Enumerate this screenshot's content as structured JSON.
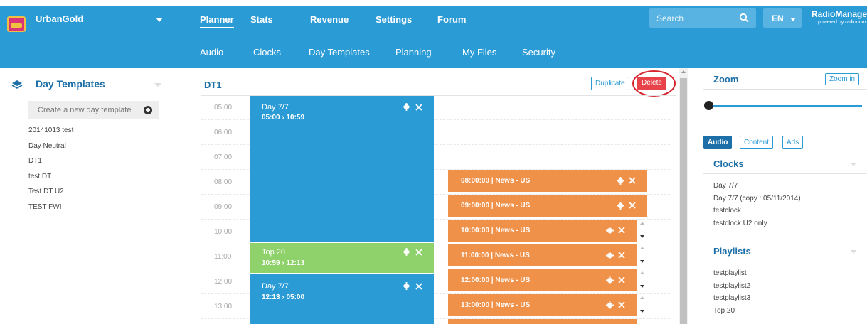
{
  "header": {
    "brand": "UrbanGold",
    "nav": [
      "Planner",
      "Stats",
      "Revenue",
      "Settings",
      "Forum"
    ],
    "active_nav": "Planner",
    "search_placeholder": "Search",
    "language": "EN",
    "product_name": "RadioManager",
    "product_tagline": "powered by radionom"
  },
  "subnav": {
    "items": [
      "Audio",
      "Clocks",
      "Day Templates",
      "Planning",
      "My Files",
      "Security"
    ],
    "active": "Day Templates"
  },
  "left_panel": {
    "title": "Day Templates",
    "create_label": "Create a new day template",
    "templates": [
      "20141013 test",
      "Day Neutral",
      "DT1",
      "test DT",
      "Test DT U2",
      "TEST FWI"
    ]
  },
  "editor": {
    "title": "DT1",
    "duplicate_label": "Duplicate",
    "delete_label": "Delete",
    "hours": [
      "05:00",
      "06:00",
      "07:00",
      "08:00",
      "09:00",
      "10:00",
      "11:00",
      "12:00",
      "13:00"
    ],
    "blocks": [
      {
        "name": "Day 7/7",
        "time": "05:00 › 10:59",
        "color": "#2b9bd6"
      },
      {
        "name": "Top 20",
        "time": "10:59 › 12:13",
        "color": "#8fd16a"
      },
      {
        "name": "Day 7/7",
        "time": "12:13 › 05:00",
        "color": "#2b9bd6"
      }
    ],
    "news_items": [
      "08:00:00 | News - US",
      "09:00:00 | News - US",
      "10:00:00 | News - US",
      "11:00:00 | News - US",
      "12:00:00 | News - US",
      "13:00:00 | News - US"
    ],
    "news_color": "#f0914a",
    "delete_color": "#e8434a"
  },
  "right_panel": {
    "zoom_title": "Zoom",
    "zoom_in_label": "Zoom in",
    "tabs": [
      "Audio",
      "Content",
      "Ads"
    ],
    "active_tab": "Audio",
    "clocks_title": "Clocks",
    "clocks": [
      "Day 7/7",
      "Day 7/7 (copy : 05/11/2014)",
      "testclock",
      "testclock U2 only"
    ],
    "playlists_title": "Playlists",
    "playlists": [
      "testplaylist",
      "testplaylist2",
      "testplaylist3",
      "Top 20"
    ]
  },
  "colors": {
    "primary": "#2b9bd6",
    "heading": "#1d6fa8"
  }
}
